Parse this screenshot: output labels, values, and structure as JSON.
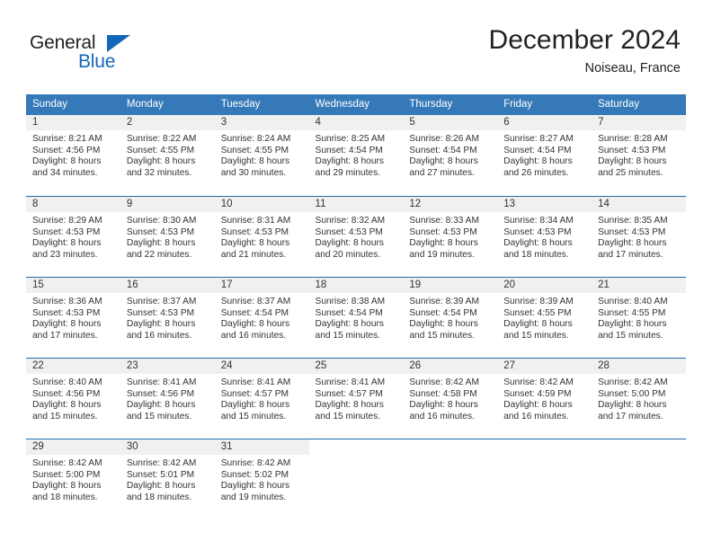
{
  "brand": {
    "name_part1": "General",
    "name_part2": "Blue",
    "accent_color": "#1565b8"
  },
  "header": {
    "title": "December 2024",
    "subtitle": "Noiseau, France"
  },
  "theme": {
    "header_row_color": "#3679b8",
    "row_divider_color": "#1f6cb0",
    "day_band_color": "#f0f0f0"
  },
  "weekdays": [
    "Sunday",
    "Monday",
    "Tuesday",
    "Wednesday",
    "Thursday",
    "Friday",
    "Saturday"
  ],
  "weeks": [
    [
      {
        "day": "1",
        "sunrise": "Sunrise: 8:21 AM",
        "sunset": "Sunset: 4:56 PM",
        "daylight1": "Daylight: 8 hours",
        "daylight2": "and 34 minutes."
      },
      {
        "day": "2",
        "sunrise": "Sunrise: 8:22 AM",
        "sunset": "Sunset: 4:55 PM",
        "daylight1": "Daylight: 8 hours",
        "daylight2": "and 32 minutes."
      },
      {
        "day": "3",
        "sunrise": "Sunrise: 8:24 AM",
        "sunset": "Sunset: 4:55 PM",
        "daylight1": "Daylight: 8 hours",
        "daylight2": "and 30 minutes."
      },
      {
        "day": "4",
        "sunrise": "Sunrise: 8:25 AM",
        "sunset": "Sunset: 4:54 PM",
        "daylight1": "Daylight: 8 hours",
        "daylight2": "and 29 minutes."
      },
      {
        "day": "5",
        "sunrise": "Sunrise: 8:26 AM",
        "sunset": "Sunset: 4:54 PM",
        "daylight1": "Daylight: 8 hours",
        "daylight2": "and 27 minutes."
      },
      {
        "day": "6",
        "sunrise": "Sunrise: 8:27 AM",
        "sunset": "Sunset: 4:54 PM",
        "daylight1": "Daylight: 8 hours",
        "daylight2": "and 26 minutes."
      },
      {
        "day": "7",
        "sunrise": "Sunrise: 8:28 AM",
        "sunset": "Sunset: 4:53 PM",
        "daylight1": "Daylight: 8 hours",
        "daylight2": "and 25 minutes."
      }
    ],
    [
      {
        "day": "8",
        "sunrise": "Sunrise: 8:29 AM",
        "sunset": "Sunset: 4:53 PM",
        "daylight1": "Daylight: 8 hours",
        "daylight2": "and 23 minutes."
      },
      {
        "day": "9",
        "sunrise": "Sunrise: 8:30 AM",
        "sunset": "Sunset: 4:53 PM",
        "daylight1": "Daylight: 8 hours",
        "daylight2": "and 22 minutes."
      },
      {
        "day": "10",
        "sunrise": "Sunrise: 8:31 AM",
        "sunset": "Sunset: 4:53 PM",
        "daylight1": "Daylight: 8 hours",
        "daylight2": "and 21 minutes."
      },
      {
        "day": "11",
        "sunrise": "Sunrise: 8:32 AM",
        "sunset": "Sunset: 4:53 PM",
        "daylight1": "Daylight: 8 hours",
        "daylight2": "and 20 minutes."
      },
      {
        "day": "12",
        "sunrise": "Sunrise: 8:33 AM",
        "sunset": "Sunset: 4:53 PM",
        "daylight1": "Daylight: 8 hours",
        "daylight2": "and 19 minutes."
      },
      {
        "day": "13",
        "sunrise": "Sunrise: 8:34 AM",
        "sunset": "Sunset: 4:53 PM",
        "daylight1": "Daylight: 8 hours",
        "daylight2": "and 18 minutes."
      },
      {
        "day": "14",
        "sunrise": "Sunrise: 8:35 AM",
        "sunset": "Sunset: 4:53 PM",
        "daylight1": "Daylight: 8 hours",
        "daylight2": "and 17 minutes."
      }
    ],
    [
      {
        "day": "15",
        "sunrise": "Sunrise: 8:36 AM",
        "sunset": "Sunset: 4:53 PM",
        "daylight1": "Daylight: 8 hours",
        "daylight2": "and 17 minutes."
      },
      {
        "day": "16",
        "sunrise": "Sunrise: 8:37 AM",
        "sunset": "Sunset: 4:53 PM",
        "daylight1": "Daylight: 8 hours",
        "daylight2": "and 16 minutes."
      },
      {
        "day": "17",
        "sunrise": "Sunrise: 8:37 AM",
        "sunset": "Sunset: 4:54 PM",
        "daylight1": "Daylight: 8 hours",
        "daylight2": "and 16 minutes."
      },
      {
        "day": "18",
        "sunrise": "Sunrise: 8:38 AM",
        "sunset": "Sunset: 4:54 PM",
        "daylight1": "Daylight: 8 hours",
        "daylight2": "and 15 minutes."
      },
      {
        "day": "19",
        "sunrise": "Sunrise: 8:39 AM",
        "sunset": "Sunset: 4:54 PM",
        "daylight1": "Daylight: 8 hours",
        "daylight2": "and 15 minutes."
      },
      {
        "day": "20",
        "sunrise": "Sunrise: 8:39 AM",
        "sunset": "Sunset: 4:55 PM",
        "daylight1": "Daylight: 8 hours",
        "daylight2": "and 15 minutes."
      },
      {
        "day": "21",
        "sunrise": "Sunrise: 8:40 AM",
        "sunset": "Sunset: 4:55 PM",
        "daylight1": "Daylight: 8 hours",
        "daylight2": "and 15 minutes."
      }
    ],
    [
      {
        "day": "22",
        "sunrise": "Sunrise: 8:40 AM",
        "sunset": "Sunset: 4:56 PM",
        "daylight1": "Daylight: 8 hours",
        "daylight2": "and 15 minutes."
      },
      {
        "day": "23",
        "sunrise": "Sunrise: 8:41 AM",
        "sunset": "Sunset: 4:56 PM",
        "daylight1": "Daylight: 8 hours",
        "daylight2": "and 15 minutes."
      },
      {
        "day": "24",
        "sunrise": "Sunrise: 8:41 AM",
        "sunset": "Sunset: 4:57 PM",
        "daylight1": "Daylight: 8 hours",
        "daylight2": "and 15 minutes."
      },
      {
        "day": "25",
        "sunrise": "Sunrise: 8:41 AM",
        "sunset": "Sunset: 4:57 PM",
        "daylight1": "Daylight: 8 hours",
        "daylight2": "and 15 minutes."
      },
      {
        "day": "26",
        "sunrise": "Sunrise: 8:42 AM",
        "sunset": "Sunset: 4:58 PM",
        "daylight1": "Daylight: 8 hours",
        "daylight2": "and 16 minutes."
      },
      {
        "day": "27",
        "sunrise": "Sunrise: 8:42 AM",
        "sunset": "Sunset: 4:59 PM",
        "daylight1": "Daylight: 8 hours",
        "daylight2": "and 16 minutes."
      },
      {
        "day": "28",
        "sunrise": "Sunrise: 8:42 AM",
        "sunset": "Sunset: 5:00 PM",
        "daylight1": "Daylight: 8 hours",
        "daylight2": "and 17 minutes."
      }
    ],
    [
      {
        "day": "29",
        "sunrise": "Sunrise: 8:42 AM",
        "sunset": "Sunset: 5:00 PM",
        "daylight1": "Daylight: 8 hours",
        "daylight2": "and 18 minutes."
      },
      {
        "day": "30",
        "sunrise": "Sunrise: 8:42 AM",
        "sunset": "Sunset: 5:01 PM",
        "daylight1": "Daylight: 8 hours",
        "daylight2": "and 18 minutes."
      },
      {
        "day": "31",
        "sunrise": "Sunrise: 8:42 AM",
        "sunset": "Sunset: 5:02 PM",
        "daylight1": "Daylight: 8 hours",
        "daylight2": "and 19 minutes."
      },
      {
        "day": "",
        "sunrise": "",
        "sunset": "",
        "daylight1": "",
        "daylight2": ""
      },
      {
        "day": "",
        "sunrise": "",
        "sunset": "",
        "daylight1": "",
        "daylight2": ""
      },
      {
        "day": "",
        "sunrise": "",
        "sunset": "",
        "daylight1": "",
        "daylight2": ""
      },
      {
        "day": "",
        "sunrise": "",
        "sunset": "",
        "daylight1": "",
        "daylight2": ""
      }
    ]
  ]
}
